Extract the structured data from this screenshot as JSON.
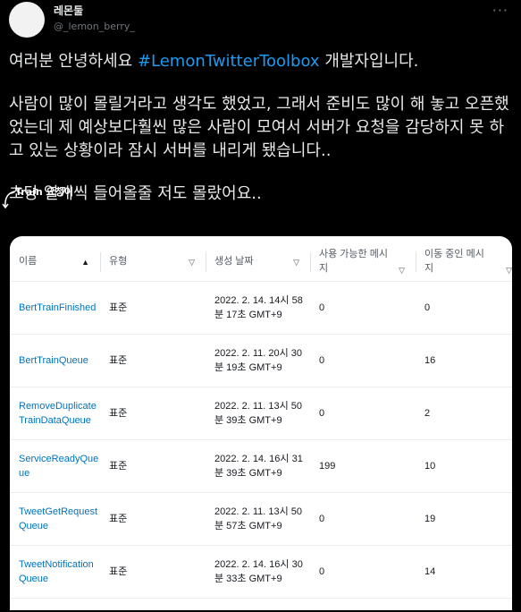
{
  "user": {
    "display_name": "레몬둘",
    "handle": "@_lemon_berry_",
    "more_label": "···"
  },
  "tweet": {
    "line1_prefix": "여러분 안녕하세요 ",
    "hashtag": "#LemonTwitterToolbox",
    "line1_suffix": " 개발자입니다.",
    "paragraph2": "사람이 많이 몰릴거라고 생각도 했었고, 그래서 준비도 많이 해 놓고 오픈했었는데 제 예상보다훨씬 많은 사람이 모여서 서버가 요청을 감당하지 못 하고 있는 상황이라 잠시 서버를 내리게 됐습니다..",
    "paragraph3": "초당 열개씩 들어올줄 저도 몰랐어요.."
  },
  "annotation": {
    "text": "Train 요청이"
  },
  "table": {
    "headers": [
      "이름",
      "유형",
      "생성 날짜",
      "사용 가능한 메시지",
      "이동 중인 메시지"
    ],
    "rows": [
      {
        "name": "BertTrainFinished",
        "type": "표준",
        "created": "2022. 2. 14. 14시 58분 17초 GMT+9",
        "available": "0",
        "in_flight": "0"
      },
      {
        "name": "BertTrainQueue",
        "type": "표준",
        "created": "2022. 2. 11. 20시 30분 19초 GMT+9",
        "available": "0",
        "in_flight": "16"
      },
      {
        "name": "RemoveDuplicateTrainDataQueue",
        "type": "표준",
        "created": "2022. 2. 11. 13시 50분 39초 GMT+9",
        "available": "0",
        "in_flight": "2"
      },
      {
        "name": "ServiceReadyQueue",
        "type": "표준",
        "created": "2022. 2. 14. 16시 31분 39초 GMT+9",
        "available": "199",
        "in_flight": "10"
      },
      {
        "name": "TweetGetRequestQueue",
        "type": "표준",
        "created": "2022. 2. 11. 13시 50분 57초 GMT+9",
        "available": "0",
        "in_flight": "19"
      },
      {
        "name": "TweetNotificationQueue",
        "type": "표준",
        "created": "2022. 2. 14. 16시 30분 33초 GMT+9",
        "available": "0",
        "in_flight": "14"
      }
    ]
  },
  "colors": {
    "background": "#000000",
    "text": "#e7e9ea",
    "secondary": "#71767b",
    "hashtag": "#1d9bf0",
    "link": "#0073bb"
  }
}
